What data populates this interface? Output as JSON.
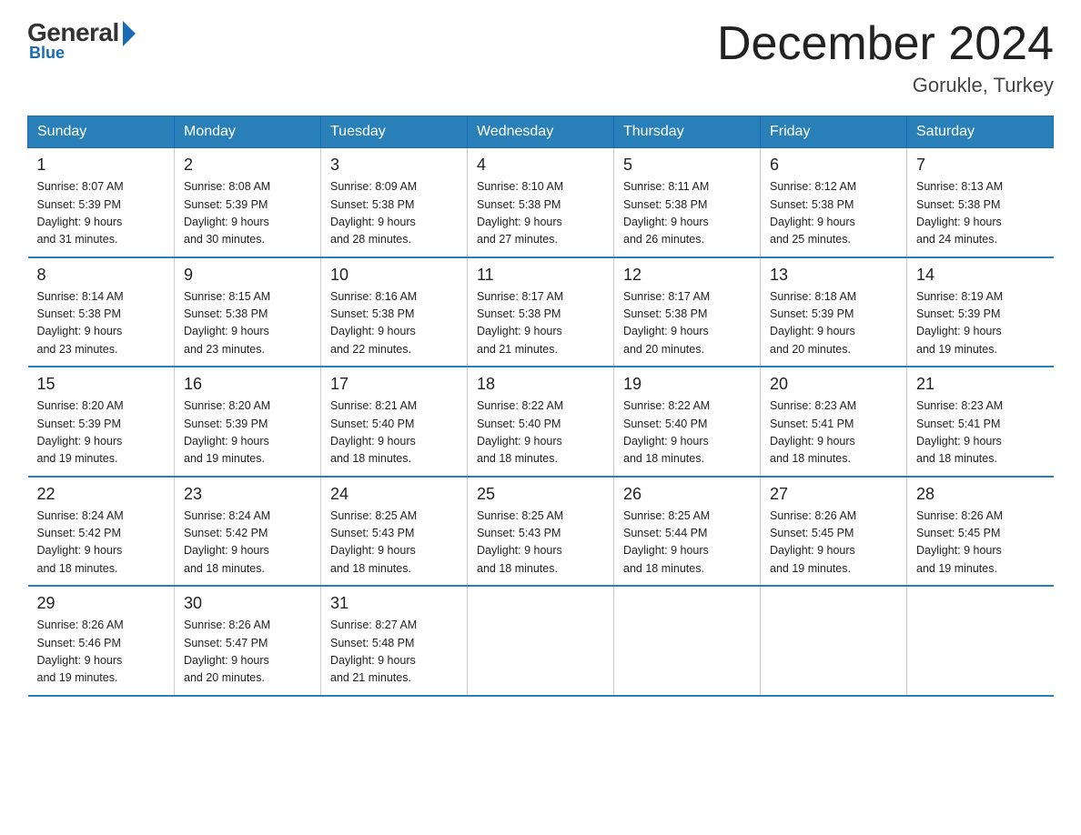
{
  "logo": {
    "general": "General",
    "blue": "Blue",
    "sub": "Blue"
  },
  "header": {
    "title": "December 2024",
    "location": "Gorukle, Turkey"
  },
  "weekdays": [
    "Sunday",
    "Monday",
    "Tuesday",
    "Wednesday",
    "Thursday",
    "Friday",
    "Saturday"
  ],
  "weeks": [
    [
      {
        "day": "1",
        "info": "Sunrise: 8:07 AM\nSunset: 5:39 PM\nDaylight: 9 hours\nand 31 minutes."
      },
      {
        "day": "2",
        "info": "Sunrise: 8:08 AM\nSunset: 5:39 PM\nDaylight: 9 hours\nand 30 minutes."
      },
      {
        "day": "3",
        "info": "Sunrise: 8:09 AM\nSunset: 5:38 PM\nDaylight: 9 hours\nand 28 minutes."
      },
      {
        "day": "4",
        "info": "Sunrise: 8:10 AM\nSunset: 5:38 PM\nDaylight: 9 hours\nand 27 minutes."
      },
      {
        "day": "5",
        "info": "Sunrise: 8:11 AM\nSunset: 5:38 PM\nDaylight: 9 hours\nand 26 minutes."
      },
      {
        "day": "6",
        "info": "Sunrise: 8:12 AM\nSunset: 5:38 PM\nDaylight: 9 hours\nand 25 minutes."
      },
      {
        "day": "7",
        "info": "Sunrise: 8:13 AM\nSunset: 5:38 PM\nDaylight: 9 hours\nand 24 minutes."
      }
    ],
    [
      {
        "day": "8",
        "info": "Sunrise: 8:14 AM\nSunset: 5:38 PM\nDaylight: 9 hours\nand 23 minutes."
      },
      {
        "day": "9",
        "info": "Sunrise: 8:15 AM\nSunset: 5:38 PM\nDaylight: 9 hours\nand 23 minutes."
      },
      {
        "day": "10",
        "info": "Sunrise: 8:16 AM\nSunset: 5:38 PM\nDaylight: 9 hours\nand 22 minutes."
      },
      {
        "day": "11",
        "info": "Sunrise: 8:17 AM\nSunset: 5:38 PM\nDaylight: 9 hours\nand 21 minutes."
      },
      {
        "day": "12",
        "info": "Sunrise: 8:17 AM\nSunset: 5:38 PM\nDaylight: 9 hours\nand 20 minutes."
      },
      {
        "day": "13",
        "info": "Sunrise: 8:18 AM\nSunset: 5:39 PM\nDaylight: 9 hours\nand 20 minutes."
      },
      {
        "day": "14",
        "info": "Sunrise: 8:19 AM\nSunset: 5:39 PM\nDaylight: 9 hours\nand 19 minutes."
      }
    ],
    [
      {
        "day": "15",
        "info": "Sunrise: 8:20 AM\nSunset: 5:39 PM\nDaylight: 9 hours\nand 19 minutes."
      },
      {
        "day": "16",
        "info": "Sunrise: 8:20 AM\nSunset: 5:39 PM\nDaylight: 9 hours\nand 19 minutes."
      },
      {
        "day": "17",
        "info": "Sunrise: 8:21 AM\nSunset: 5:40 PM\nDaylight: 9 hours\nand 18 minutes."
      },
      {
        "day": "18",
        "info": "Sunrise: 8:22 AM\nSunset: 5:40 PM\nDaylight: 9 hours\nand 18 minutes."
      },
      {
        "day": "19",
        "info": "Sunrise: 8:22 AM\nSunset: 5:40 PM\nDaylight: 9 hours\nand 18 minutes."
      },
      {
        "day": "20",
        "info": "Sunrise: 8:23 AM\nSunset: 5:41 PM\nDaylight: 9 hours\nand 18 minutes."
      },
      {
        "day": "21",
        "info": "Sunrise: 8:23 AM\nSunset: 5:41 PM\nDaylight: 9 hours\nand 18 minutes."
      }
    ],
    [
      {
        "day": "22",
        "info": "Sunrise: 8:24 AM\nSunset: 5:42 PM\nDaylight: 9 hours\nand 18 minutes."
      },
      {
        "day": "23",
        "info": "Sunrise: 8:24 AM\nSunset: 5:42 PM\nDaylight: 9 hours\nand 18 minutes."
      },
      {
        "day": "24",
        "info": "Sunrise: 8:25 AM\nSunset: 5:43 PM\nDaylight: 9 hours\nand 18 minutes."
      },
      {
        "day": "25",
        "info": "Sunrise: 8:25 AM\nSunset: 5:43 PM\nDaylight: 9 hours\nand 18 minutes."
      },
      {
        "day": "26",
        "info": "Sunrise: 8:25 AM\nSunset: 5:44 PM\nDaylight: 9 hours\nand 18 minutes."
      },
      {
        "day": "27",
        "info": "Sunrise: 8:26 AM\nSunset: 5:45 PM\nDaylight: 9 hours\nand 19 minutes."
      },
      {
        "day": "28",
        "info": "Sunrise: 8:26 AM\nSunset: 5:45 PM\nDaylight: 9 hours\nand 19 minutes."
      }
    ],
    [
      {
        "day": "29",
        "info": "Sunrise: 8:26 AM\nSunset: 5:46 PM\nDaylight: 9 hours\nand 19 minutes."
      },
      {
        "day": "30",
        "info": "Sunrise: 8:26 AM\nSunset: 5:47 PM\nDaylight: 9 hours\nand 20 minutes."
      },
      {
        "day": "31",
        "info": "Sunrise: 8:27 AM\nSunset: 5:48 PM\nDaylight: 9 hours\nand 21 minutes."
      },
      null,
      null,
      null,
      null
    ]
  ]
}
